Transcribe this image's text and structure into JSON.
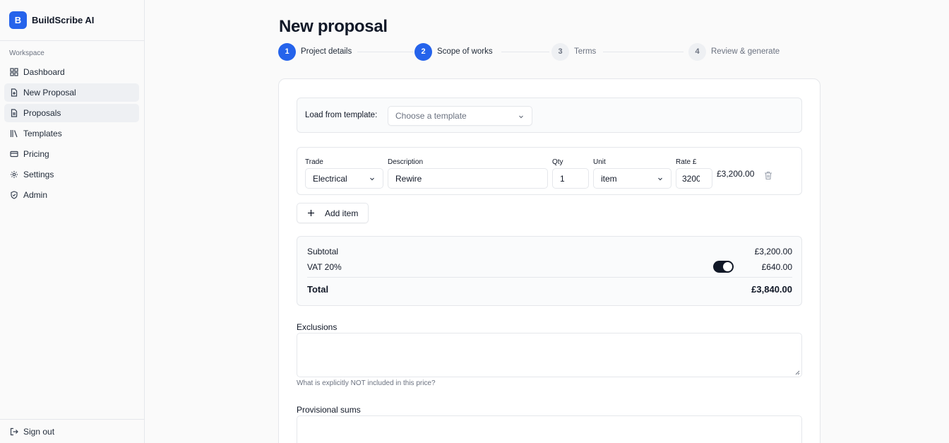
{
  "brand": {
    "logo_letter": "B",
    "name": "BuildScribe AI",
    "accent": "#2563eb"
  },
  "sidebar": {
    "section_label": "Workspace",
    "items": [
      {
        "label": "Dashboard",
        "icon": "grid-icon"
      },
      {
        "label": "New Proposal",
        "icon": "file-plus-icon"
      },
      {
        "label": "Proposals",
        "icon": "file-text-icon"
      },
      {
        "label": "Templates",
        "icon": "library-icon"
      },
      {
        "label": "Pricing",
        "icon": "credit-card-icon"
      },
      {
        "label": "Settings",
        "icon": "gear-icon"
      },
      {
        "label": "Admin",
        "icon": "shield-icon"
      }
    ],
    "sign_out": "Sign out"
  },
  "page": {
    "title": "New proposal"
  },
  "stepper": {
    "steps": [
      {
        "num": "1",
        "label": "Project details",
        "state": "done"
      },
      {
        "num": "2",
        "label": "Scope of works",
        "state": "current"
      },
      {
        "num": "3",
        "label": "Terms",
        "state": "todo"
      },
      {
        "num": "4",
        "label": "Review & generate",
        "state": "todo"
      }
    ]
  },
  "template": {
    "label": "Load from template:",
    "placeholder": "Choose a template"
  },
  "line_items": {
    "headers": {
      "trade": "Trade",
      "description": "Description",
      "qty": "Qty",
      "unit": "Unit",
      "rate": "Rate £"
    },
    "rows": [
      {
        "trade": "Electrical",
        "description": "Rewire",
        "qty": "1",
        "unit": "item",
        "rate": "3200",
        "total": "£3,200.00"
      }
    ],
    "add_label": "Add item"
  },
  "totals": {
    "subtotal_label": "Subtotal",
    "subtotal": "£3,200.00",
    "vat_label": "VAT 20%",
    "vat": "£640.00",
    "vat_enabled": true,
    "total_label": "Total",
    "total": "£3,840.00"
  },
  "exclusions": {
    "label": "Exclusions",
    "value": "",
    "hint": "What is explicitly NOT included in this price?"
  },
  "provisional": {
    "label": "Provisional sums",
    "value": ""
  }
}
